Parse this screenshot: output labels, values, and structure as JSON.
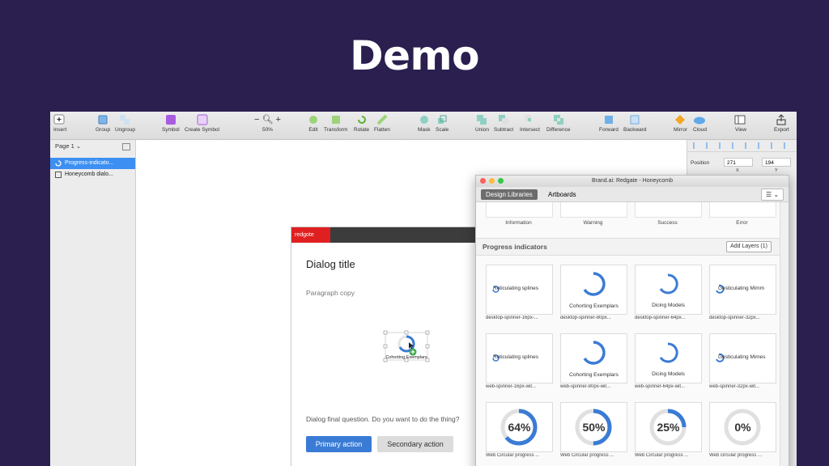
{
  "slide": {
    "title": "Demo"
  },
  "toolbar": {
    "items": [
      {
        "label": "Insert"
      },
      {
        "label": "Group"
      },
      {
        "label": "Ungroup"
      },
      {
        "label": "Symbol"
      },
      {
        "label": "Create Symbol"
      },
      {
        "label": "50%"
      },
      {
        "label": "Edit"
      },
      {
        "label": "Transform"
      },
      {
        "label": "Rotate"
      },
      {
        "label": "Flatten"
      },
      {
        "label": "Mask"
      },
      {
        "label": "Scale"
      },
      {
        "label": "Union"
      },
      {
        "label": "Subtract"
      },
      {
        "label": "Intersect"
      },
      {
        "label": "Difference"
      },
      {
        "label": "Forward"
      },
      {
        "label": "Backward"
      },
      {
        "label": "Mirror"
      },
      {
        "label": "Cloud"
      },
      {
        "label": "View"
      },
      {
        "label": "Export"
      }
    ]
  },
  "sidebar": {
    "page": "Page 1 ⌄",
    "layers": [
      {
        "label": "Progress-indicato..."
      },
      {
        "label": "Honeycomb dialo..."
      }
    ]
  },
  "inspector": {
    "position_label": "Position",
    "x_value": "271",
    "y_value": "194",
    "x_label": "X",
    "y_label": "Y"
  },
  "dialog": {
    "logo": "redgote",
    "close": "✕",
    "title": "Dialog title",
    "paragraph": "Paragraph copy",
    "selected_label": "Cohorting Exemplars",
    "question": "Dialog final question. Do you want to do the thing?",
    "primary": "Primary action",
    "secondary": "Secondary action"
  },
  "panel": {
    "title": "Brand.ai: Redgate - Honeycomb",
    "tabs": [
      "Design Libraries",
      "Artboards"
    ],
    "menu": "☰ ⌄",
    "top_labels": [
      "Information",
      "Warning",
      "Success",
      "Error"
    ],
    "section_title": "Progress indicators",
    "add_layers": "Add Layers (1)",
    "rows": [
      [
        {
          "text": "Reticulating splines",
          "label": "desktop-spinner-16px-..."
        },
        {
          "text": "Cohorting Exemplars",
          "label": "desktop-spinner-80px..."
        },
        {
          "text": "Dicing Models",
          "label": "desktop-spinner-64px..."
        },
        {
          "text": "Gesticulating Mimm",
          "label": "desktop-spinner-32px..."
        }
      ],
      [
        {
          "text": "Reticulating splines",
          "label": "web-spinner-16px-wit..."
        },
        {
          "text": "Cohorting Exemplars",
          "label": "web-spinner-80px-wit..."
        },
        {
          "text": "Dicing Models",
          "label": "web-spinner-64px-wit..."
        },
        {
          "text": "Gesticulating Mimes",
          "label": "web-spinner-32px-wit..."
        }
      ],
      [
        {
          "text": "64%",
          "value": 64,
          "label": "Web Circular progress ..."
        },
        {
          "text": "50%",
          "value": 50,
          "label": "Web Circular progress ..."
        },
        {
          "text": "25%",
          "value": 25,
          "label": "Web Circular progress ..."
        },
        {
          "text": "0%",
          "value": 0,
          "label": "Web circular progress ..."
        }
      ]
    ]
  },
  "colors": {
    "slide_bg": "#2a1f4e",
    "accent_blue": "#3a7bd5",
    "selection_blue": "#3d8ff1",
    "redgate_red": "#e02020"
  }
}
